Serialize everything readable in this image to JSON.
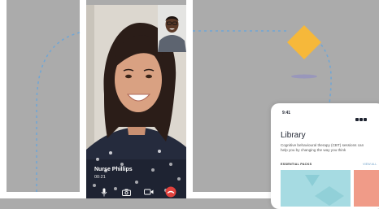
{
  "call": {
    "caller_name": "Nurse Phillips",
    "call_time": "00:21"
  },
  "library_card": {
    "status_time": "9:41",
    "title": "Library",
    "description": "Cognitive behavioural therapy (CBT) sessions can help you by changing the way you think",
    "section_label": "ESSENTIAL PACKS",
    "view_all": "VIEW ALL"
  },
  "colors": {
    "background": "#ababab",
    "accent_diamond": "#f6b83a",
    "dotted_path": "#6fa6d6",
    "end_call": "#e0413d",
    "pack_teal": "#a6dbe2",
    "pack_coral": "#f09b88"
  },
  "icons": [
    "microphone-icon",
    "camera-icon",
    "video-icon",
    "end-call-icon",
    "diamond-icon"
  ]
}
